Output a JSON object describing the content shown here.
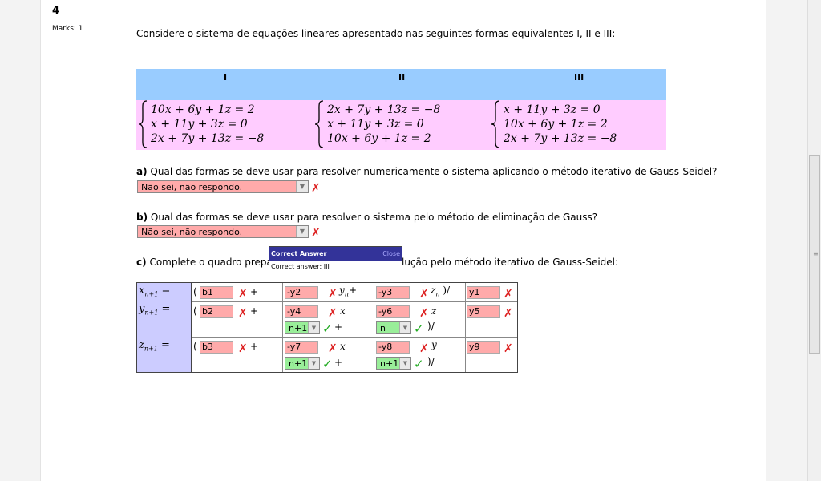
{
  "question": {
    "number": "4",
    "marks": "Marks: 1",
    "text": "Considere o sistema de equações lineares apresentado nas seguintes formas equivalentes I, II e III:"
  },
  "forms": {
    "headers": [
      "I",
      "II",
      "III"
    ],
    "systems": [
      [
        "10x + 6y + 1z = 2",
        "x + 11y + 3z = 0",
        "2x + 7y + 13z = −8"
      ],
      [
        "2x + 7y + 13z = −8",
        "x + 11y + 3z = 0",
        "10x + 6y + 1z = 2"
      ],
      [
        "x + 11y + 3z = 0",
        "10x + 6y + 1z = 2",
        "2x + 7y + 13z = −8"
      ]
    ]
  },
  "part_a": {
    "label": "a)",
    "text": "Qual das formas se deve usar para resolver numericamente o sistema aplicando o método iterativo de Gauss-Seidel?",
    "selected": "Não sei, não respondo."
  },
  "part_b": {
    "label": "b)",
    "text": "Qual das formas se deve usar para resolver o sistema pelo método de eliminação de Gauss?",
    "selected": "Não sei, não respondo."
  },
  "part_c": {
    "label": "c)",
    "text_before": "Complete o quadro prepara",
    "text_after": "lução pelo método iterativo de Gauss-Seidel:"
  },
  "popup": {
    "title": "Correct Answer",
    "close": "Close",
    "body": "Correct answer: III"
  },
  "grid": {
    "lhs": [
      "x",
      "y",
      "z"
    ],
    "lhs_sub": "n+1",
    "eq": "=",
    "paren_open": "(",
    "paren_close": ")",
    "slash": "/",
    "plus": "+",
    "row1": {
      "c1": "b1",
      "c2": "-y2",
      "c2_var": "y",
      "c2_sub": "n",
      "c3": "-y3",
      "c3_var": "z",
      "c3_sub": "n",
      "c4": "y1"
    },
    "row2": {
      "c1": "b2",
      "c2": "-y4",
      "c2_var": "x",
      "c2_sel": "n+1",
      "c3": "-y6",
      "c3_var": "z",
      "c3_sel": "n",
      "c4": "y5"
    },
    "row3": {
      "c1": "b3",
      "c2": "-y7",
      "c2_var": "x",
      "c2_sel": "n+1",
      "c3": "-y8",
      "c3_var": "y",
      "c3_sel": "n+1",
      "c4": "y9"
    }
  },
  "colors": {
    "header_blue": "#99ccff",
    "forms_pink": "#ffccff",
    "wrong_red": "#ffaaaa",
    "right_green": "#99ee99",
    "popup_bar": "#333399"
  },
  "icons": {
    "wrong": "cross-icon",
    "right": "check-icon",
    "dropdown": "chevron-down-icon"
  }
}
